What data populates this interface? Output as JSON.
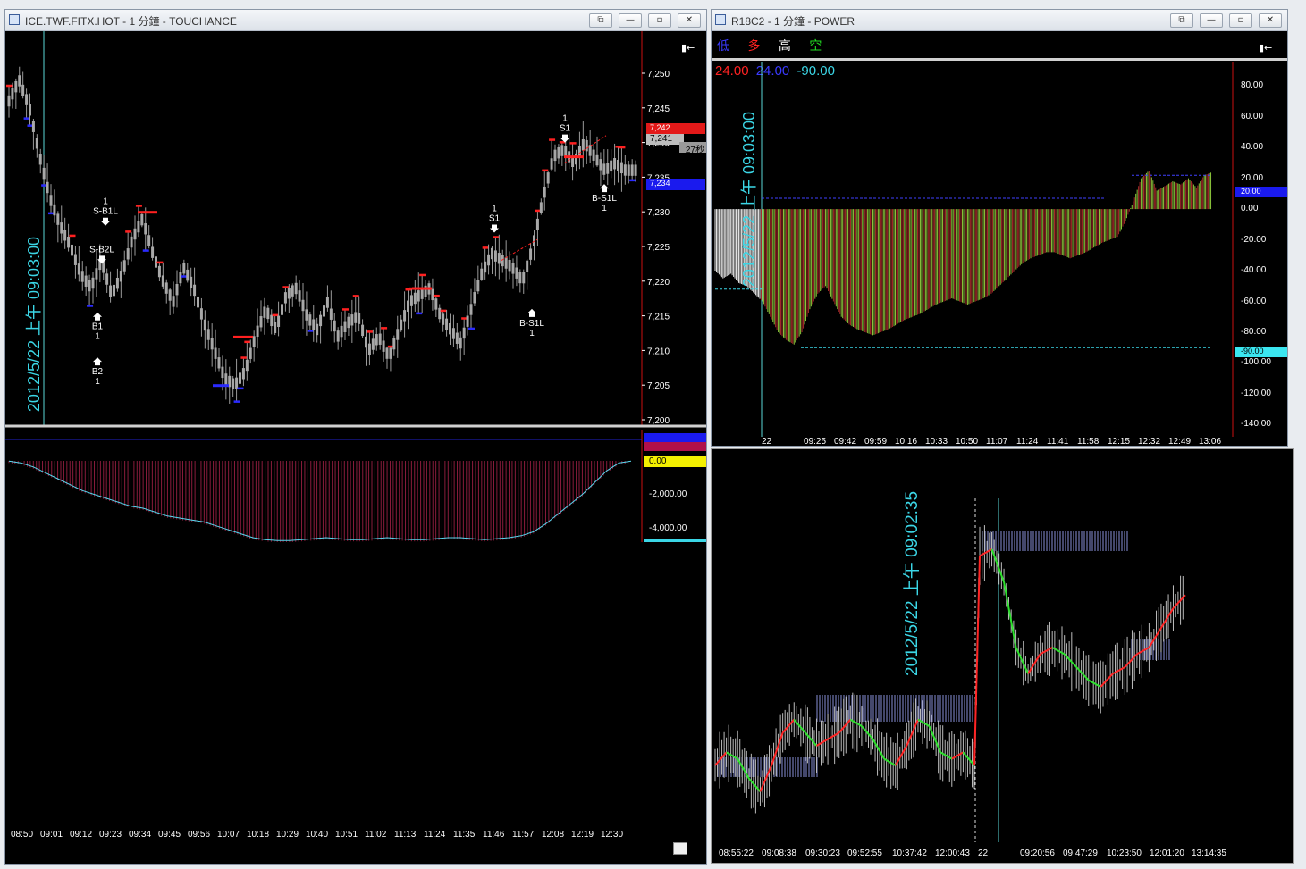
{
  "windows": {
    "left": {
      "title": "ICE.TWF.FITX.HOT - 1 分鐘 - TOUCHANCE"
    },
    "right": {
      "title": "R18C2 - 1 分鐘 - POWER"
    }
  },
  "icons": {
    "restore": "restore-icon",
    "minimize": "minimize-icon",
    "maximize": "maximize-icon",
    "close": "close-icon",
    "panel_toggle": "panel-toggle-icon"
  },
  "chart_data": [
    {
      "type": "ohlc",
      "id": "left-price",
      "y_ticks": [
        "7,250",
        "7,245",
        "7,240",
        "7,235",
        "7,230",
        "7,225",
        "7,220",
        "7,215",
        "7,210",
        "7,205",
        "7,200"
      ],
      "ylim": [
        7200,
        7250
      ],
      "x_ticks": [
        "08:50",
        "09:01",
        "09:12",
        "09:23",
        "09:34",
        "09:45",
        "09:56",
        "10:07",
        "10:18",
        "10:29",
        "10:40",
        "10:51",
        "11:02",
        "11:13",
        "11:24",
        "11:35",
        "11:46",
        "11:57",
        "12:08",
        "12:19",
        "12:30"
      ],
      "price_tags": {
        "high": "7,242",
        "last": "7,241",
        "low": "7,234",
        "timer": "27秒"
      },
      "timestamp_label": "2012/5/22 上午 09:03:00",
      "close_path": [
        7246,
        7249,
        7245,
        7238,
        7232,
        7228,
        7225,
        7221,
        7219,
        7223,
        7218,
        7221,
        7226,
        7229,
        7224,
        7220,
        7217,
        7222,
        7219,
        7214,
        7210,
        7206,
        7205,
        7207,
        7212,
        7216,
        7213,
        7218,
        7219,
        7215,
        7213,
        7217,
        7212,
        7214,
        7215,
        7210,
        7212,
        7209,
        7213,
        7217,
        7218,
        7219,
        7215,
        7213,
        7211,
        7216,
        7221,
        7224,
        7223,
        7222,
        7220,
        7225,
        7232,
        7238,
        7239,
        7237,
        7240,
        7238,
        7236,
        7237,
        7236,
        7236
      ],
      "signals": [
        {
          "label": "S-B1L",
          "num": "1",
          "dir": "down"
        },
        {
          "label": "S-B2L",
          "num": "",
          "dir": "down"
        },
        {
          "label": "B1",
          "num": "1",
          "dir": "up"
        },
        {
          "label": "B2",
          "num": "1",
          "dir": "up"
        },
        {
          "label": "S1",
          "num": "1",
          "dir": "down"
        },
        {
          "label": "B-S1L",
          "num": "1",
          "dir": "up"
        },
        {
          "label": "S1",
          "num": "1",
          "dir": "down"
        },
        {
          "label": "B-S1L",
          "num": "1",
          "dir": "up"
        }
      ]
    },
    {
      "type": "bar",
      "id": "left-indicator",
      "y_ticks": [
        "0.00",
        "-2,000.00",
        "-4,000.00"
      ],
      "tags": [
        "0.00"
      ],
      "values": [
        -100,
        -200,
        -400,
        -700,
        -1000,
        -1300,
        -1600,
        -1800,
        -2000,
        -2200,
        -2400,
        -2500,
        -2700,
        -2900,
        -3000,
        -3100,
        -3200,
        -3400,
        -3600,
        -3800,
        -4000,
        -4100,
        -4150,
        -4150,
        -4100,
        -4050,
        -4000,
        -4050,
        -4100,
        -4100,
        -4050,
        -4000,
        -4050,
        -4100,
        -4100,
        -4050,
        -4000,
        -4000,
        -4050,
        -4100,
        -4050,
        -4000,
        -3900,
        -3700,
        -3300,
        -2800,
        -2300,
        -1800,
        -1200,
        -600,
        -200,
        -100
      ]
    },
    {
      "type": "bar",
      "id": "right-power",
      "legend": [
        "低",
        "多",
        "高",
        "空"
      ],
      "readout": [
        "24.00",
        "24.00",
        "-90.00"
      ],
      "y_ticks": [
        "80.00",
        "60.00",
        "40.00",
        "20.00",
        "0.00",
        "-20.00",
        "-40.00",
        "-60.00",
        "-80.00",
        "-100.00",
        "-120.00",
        "-140.00"
      ],
      "ylim": [
        -145,
        90
      ],
      "tags": [
        "20.00",
        "-90.00"
      ],
      "x_ticks": [
        "22",
        "09:25",
        "09:42",
        "09:59",
        "10:16",
        "10:33",
        "10:50",
        "11:07",
        "11:24",
        "11:41",
        "11:58",
        "12:15",
        "12:32",
        "12:49",
        "13:06"
      ],
      "timestamp_label": "2012/5/22 上午 09:03:00",
      "values": [
        -40,
        -45,
        -42,
        -48,
        -50,
        -55,
        -60,
        -70,
        -80,
        -85,
        -88,
        -80,
        -65,
        -55,
        -50,
        -60,
        -70,
        -75,
        -78,
        -80,
        -82,
        -80,
        -78,
        -75,
        -72,
        -70,
        -68,
        -65,
        -62,
        -60,
        -58,
        -60,
        -62,
        -60,
        -58,
        -55,
        -50,
        -45,
        -40,
        -35,
        -32,
        -30,
        -28,
        -28,
        -30,
        -32,
        -30,
        -28,
        -25,
        -22,
        -20,
        -18,
        -8,
        5,
        20,
        25,
        12,
        15,
        18,
        16,
        20,
        14,
        22,
        24
      ]
    },
    {
      "type": "line",
      "id": "right-tick",
      "x_ticks": [
        "08:55:22",
        "09:08:38",
        "09:30:23",
        "09:52:55",
        "10:37:42",
        "12:00:43",
        "22",
        "09:20:56",
        "09:47:29",
        "10:23:50",
        "12:01:20",
        "13:14:35"
      ],
      "timestamp_label": "2012/5/22 上午 09:02:35",
      "values": [
        7214,
        7216,
        7215,
        7212,
        7210,
        7214,
        7219,
        7221,
        7219,
        7217,
        7218,
        7219,
        7221,
        7220,
        7218,
        7215,
        7214,
        7217,
        7221,
        7220,
        7216,
        7215,
        7216,
        7214,
        7246,
        7247,
        7242,
        7232,
        7228,
        7231,
        7232,
        7231,
        7229,
        7227,
        7226,
        7228,
        7229,
        7231,
        7232,
        7235,
        7238,
        7240
      ]
    }
  ]
}
